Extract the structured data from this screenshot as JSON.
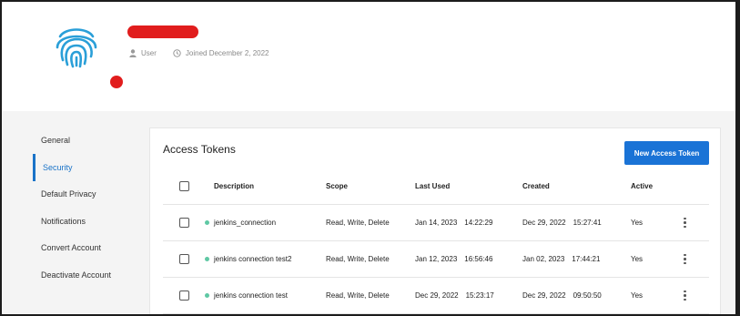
{
  "profile": {
    "role": "User",
    "joined": "Joined December 2, 2022"
  },
  "sidebar": {
    "items": [
      {
        "label": "General",
        "active": false
      },
      {
        "label": "Security",
        "active": true
      },
      {
        "label": "Default Privacy",
        "active": false
      },
      {
        "label": "Notifications",
        "active": false
      },
      {
        "label": "Convert Account",
        "active": false
      },
      {
        "label": "Deactivate Account",
        "active": false
      }
    ]
  },
  "tokens": {
    "title": "Access Tokens",
    "new_button": "New Access Token",
    "columns": {
      "description": "Description",
      "scope": "Scope",
      "last_used": "Last Used",
      "created": "Created",
      "active": "Active"
    },
    "rows": [
      {
        "description": "jenkins_connection",
        "scope": "Read, Write, Delete",
        "last_used_date": "Jan 14, 2023",
        "last_used_time": "14:22:29",
        "created_date": "Dec 29, 2022",
        "created_time": "15:27:41",
        "active": "Yes"
      },
      {
        "description": "jenkins connection test2",
        "scope": "Read, Write, Delete",
        "last_used_date": "Jan 12, 2023",
        "last_used_time": "16:56:46",
        "created_date": "Jan 02, 2023",
        "created_time": "17:44:21",
        "active": "Yes"
      },
      {
        "description": "jenkins connection test",
        "scope": "Read, Write, Delete",
        "last_used_date": "Dec 29, 2022",
        "last_used_time": "15:23:17",
        "created_date": "Dec 29, 2022",
        "created_time": "09:50:50",
        "active": "Yes"
      }
    ]
  },
  "colors": {
    "accent": "#1a73c8",
    "button": "#1a73d6",
    "redaction": "#e11d1d",
    "status_dot": "#5fc8a4",
    "fingerprint": "#2a9fd8"
  },
  "icons": [
    "fingerprint-icon",
    "user-icon",
    "clock-icon",
    "more-vertical-icon"
  ]
}
